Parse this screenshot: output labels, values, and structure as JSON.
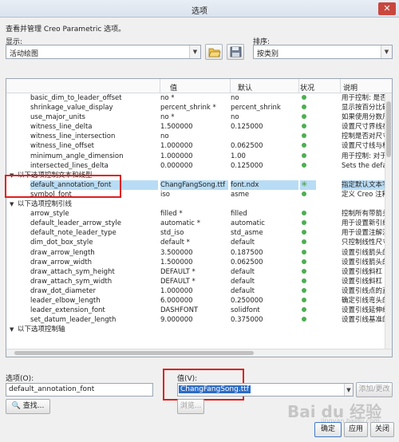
{
  "window": {
    "title": "选项",
    "close_glyph": "✕"
  },
  "header": {
    "description": "查看并管理 Creo Parametric 选项。"
  },
  "display": {
    "label": "显示:",
    "value": "活动绘图"
  },
  "sort": {
    "label": "排序:",
    "value": "按类别"
  },
  "table": {
    "columns": [
      "",
      "值",
      "默认",
      "状况",
      "说明"
    ],
    "rows": [
      {
        "kind": "item",
        "name": "basic_dim_to_leader_offset",
        "value": "no *",
        "default": "no",
        "status": "dot",
        "desc": "用于控制: 是否在"
      },
      {
        "kind": "item",
        "name": "shrinkage_value_display",
        "value": "percent_shrink *",
        "default": "percent_shrink",
        "status": "dot",
        "desc": "显示按百分比确"
      },
      {
        "kind": "item",
        "name": "use_major_units",
        "value": "no *",
        "default": "no",
        "status": "dot",
        "desc": "如果使用分数尺"
      },
      {
        "kind": "item",
        "name": "witness_line_delta",
        "value": "1.500000",
        "default": "0.125000",
        "status": "dot",
        "desc": "设置尺寸界线在"
      },
      {
        "kind": "item",
        "name": "witness_line_intersection",
        "value": "no",
        "default": "",
        "status": "dot",
        "desc": "控制是否对尺寸"
      },
      {
        "kind": "item",
        "name": "witness_line_offset",
        "value": "1.000000",
        "default": "0.062500",
        "status": "dot",
        "desc": "设置尺寸线与标"
      },
      {
        "kind": "item",
        "name": "minimum_angle_dimension",
        "value": "1.000000",
        "default": "1.00",
        "status": "dot",
        "desc": "用于控制: 对于"
      },
      {
        "kind": "item",
        "name": "intersected_lines_delta",
        "value": "0.000000",
        "default": "0.125000",
        "status": "dot",
        "desc": "Sets the defaul"
      },
      {
        "kind": "group",
        "name": "以下选项控制文本和线型"
      },
      {
        "kind": "item",
        "name": "default_annotation_font",
        "value": "ChangFangSong.ttf",
        "default": "font.ndx",
        "status": "star",
        "desc": "指定默认文本字",
        "highlight": true
      },
      {
        "kind": "item",
        "name": "symbol_font",
        "value": "iso",
        "default": "asme",
        "status": "dot",
        "desc": "定义 Creo 注释"
      },
      {
        "kind": "group",
        "name": "以下选项控制引线"
      },
      {
        "kind": "item",
        "name": "arrow_style",
        "value": "filled *",
        "default": "filled",
        "status": "dot",
        "desc": "控制所有带箭头"
      },
      {
        "kind": "item",
        "name": "default_leader_arrow_style",
        "value": "automatic *",
        "default": "automatic",
        "status": "dot",
        "desc": "用于设置新引线的"
      },
      {
        "kind": "item",
        "name": "default_note_leader_type",
        "value": "std_iso",
        "default": "std_asme",
        "status": "dot",
        "desc": "用于设置注解注"
      },
      {
        "kind": "item",
        "name": "dim_dot_box_style",
        "value": "default *",
        "default": "default",
        "status": "dot",
        "desc": "只控制线性尺寸"
      },
      {
        "kind": "item",
        "name": "draw_arrow_length",
        "value": "3.500000",
        "default": "0.187500",
        "status": "dot",
        "desc": "设置引线箭头的"
      },
      {
        "kind": "item",
        "name": "draw_arrow_width",
        "value": "1.500000",
        "default": "0.062500",
        "status": "dot",
        "desc": "设置引线箭头的"
      },
      {
        "kind": "item",
        "name": "draw_attach_sym_height",
        "value": "DEFAULT *",
        "default": "default",
        "status": "dot",
        "desc": "设置引线斜杠"
      },
      {
        "kind": "item",
        "name": "draw_attach_sym_width",
        "value": "DEFAULT *",
        "default": "default",
        "status": "dot",
        "desc": "设置引线斜杠"
      },
      {
        "kind": "item",
        "name": "draw_dot_diameter",
        "value": "1.000000",
        "default": "default",
        "status": "dot",
        "desc": "设置引线点的直"
      },
      {
        "kind": "item",
        "name": "leader_elbow_length",
        "value": "6.000000",
        "default": "0.250000",
        "status": "dot",
        "desc": "确定引线弯头的"
      },
      {
        "kind": "item",
        "name": "leader_extension_font",
        "value": "DASHFONT",
        "default": "solidfont",
        "status": "dot",
        "desc": "设置引线延伸线"
      },
      {
        "kind": "item",
        "name": "set_datum_leader_length",
        "value": "9.000000",
        "default": "0.375000",
        "status": "dot",
        "desc": "设置引线基准的"
      },
      {
        "kind": "group",
        "name": "以下选项控制轴"
      }
    ]
  },
  "option": {
    "label": "选项(O):",
    "value": "default_annotation_font"
  },
  "value": {
    "label": "值(V):",
    "value": "ChangFangSong.ttf"
  },
  "buttons": {
    "add_change": "添加/更改",
    "find": "查找...",
    "browse": "浏览...",
    "ok": "确定",
    "apply": "应用",
    "close": "关闭"
  },
  "watermark": {
    "brand": "Bai du 经验",
    "sub": "jingyan.baidu.com"
  },
  "colors": {
    "status_dot": "#4caf50",
    "highlight": "#b8dcf5",
    "callout": "#e01e1e",
    "selection": "#2d6cc4"
  }
}
